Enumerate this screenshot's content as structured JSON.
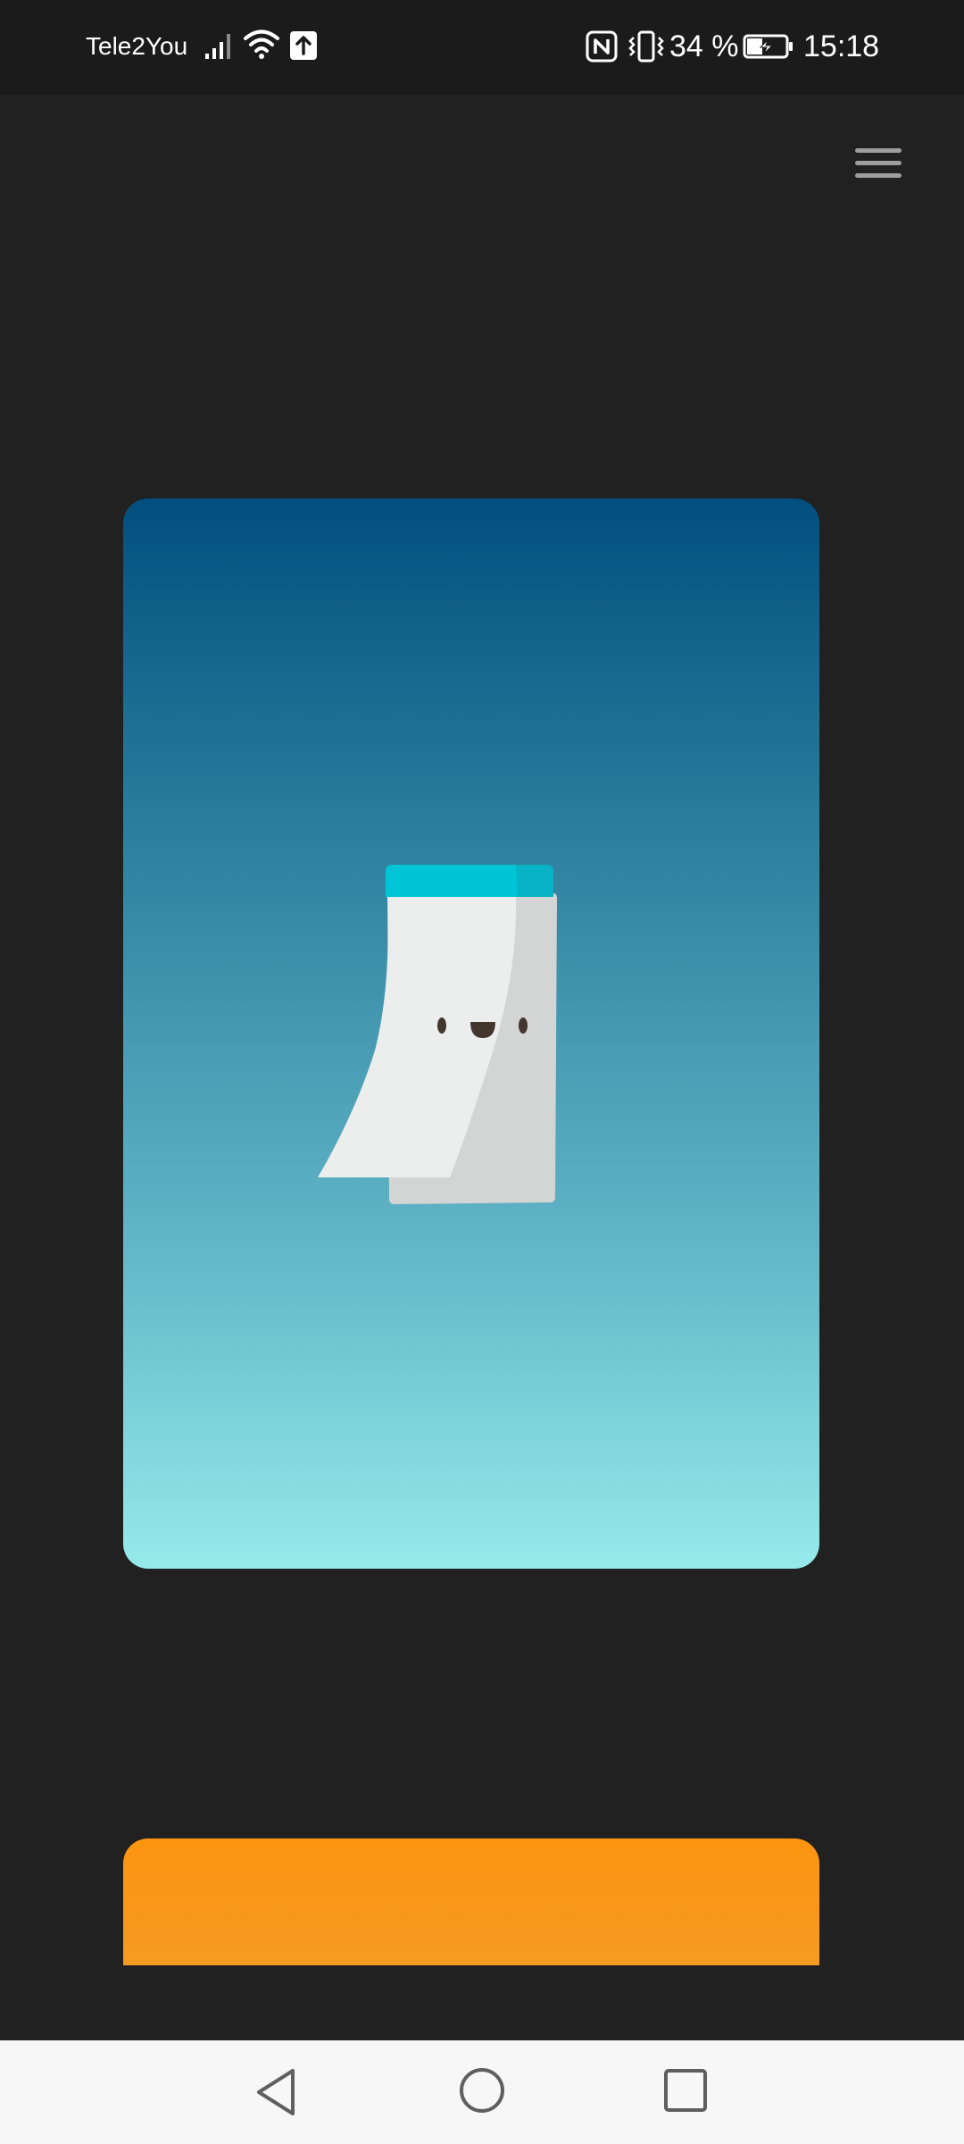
{
  "status_bar": {
    "carrier": "Tele2You",
    "battery_percent": "34 %",
    "time": "15:18",
    "icons": [
      "signal-icon",
      "wifi-icon",
      "upload-icon",
      "nfc-icon",
      "vibrate-icon",
      "battery-charging-icon"
    ]
  },
  "toolbar": {
    "menu_icon": "hamburger-menu-icon"
  },
  "cards": [
    {
      "name": "blue-gradient-card",
      "colors": [
        "#024f7f",
        "#96eaea"
      ],
      "illustration": "smiling-notepad"
    },
    {
      "name": "orange-card",
      "colors": [
        "#fd9510",
        "#f59a22"
      ]
    }
  ],
  "nav_bar": {
    "icons": [
      "back-icon",
      "home-icon",
      "recent-apps-icon"
    ]
  }
}
